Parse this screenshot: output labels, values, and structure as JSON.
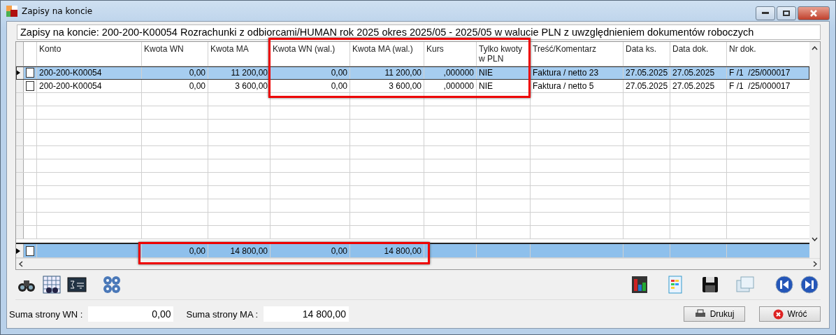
{
  "window": {
    "title": "Zapisy na koncie"
  },
  "info": "Zapisy na koncie: 200-200-K00054 Rozrachunki z odbiorcami/HUMAN rok 2025 okres 2025/05 - 2025/05 w walucie PLN z uwzględnieniem dokumentów roboczych",
  "table": {
    "columns": [
      "Konto",
      "Kwota WN",
      "Kwota MA",
      "Kwota WN (wal.)",
      "Kwota MA (wal.)",
      "Kurs",
      "Tylko kwoty w PLN",
      "Treść/Komentarz",
      "Data ks.",
      "Data dok.",
      "Nr dok."
    ],
    "rows": [
      {
        "selected": true,
        "checked": false,
        "cells": [
          "200-200-K00054",
          "0,00",
          "11 200,00",
          "0,00",
          "11 200,00",
          ",000000",
          "NIE",
          "Faktura / netto 23",
          "27.05.2025",
          "27.05.2025",
          "F /1  /25/000017"
        ]
      },
      {
        "selected": false,
        "checked": false,
        "cells": [
          "200-200-K00054",
          "0,00",
          "3 600,00",
          "0,00",
          "3 600,00",
          ",000000",
          "NIE",
          "Faktura / netto 5",
          "27.05.2025",
          "27.05.2025",
          "F /1  /25/000017"
        ]
      }
    ],
    "totals": {
      "checked": false,
      "cells": [
        "",
        "0,00",
        "14 800,00",
        "0,00",
        "14 800,00",
        "",
        "",
        "",
        "",
        "",
        ""
      ]
    }
  },
  "sums": [
    {
      "label": "Suma strony WN :",
      "value": "0,00"
    },
    {
      "label": "Suma strony MA :",
      "value": "14 800,00"
    }
  ],
  "buttons": [
    {
      "kind": "print",
      "label": "Drukuj"
    },
    {
      "kind": "back",
      "label": "Wróć"
    }
  ]
}
